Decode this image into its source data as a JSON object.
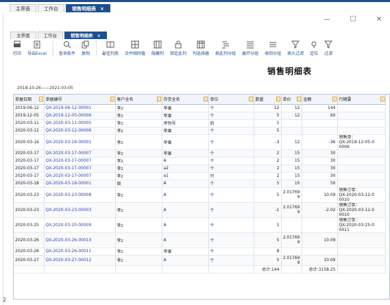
{
  "outer_tabs": [
    {
      "label": "主界面",
      "active": false
    },
    {
      "label": "工作台",
      "active": false
    },
    {
      "label": "销售明细表",
      "active": true,
      "closable": "×"
    }
  ],
  "window_controls": {
    "minimize": "—",
    "maximize": "☐",
    "close": "✕"
  },
  "inner_tabs": [
    {
      "label": "主界面",
      "active": false
    },
    {
      "label": "工作台",
      "active": false
    },
    {
      "label": "销售明细表",
      "active": true,
      "closable": "×"
    }
  ],
  "toolbar": [
    {
      "label": "打印",
      "icon": "printer-icon"
    },
    {
      "label": "导出Excel",
      "icon": "export-icon"
    },
    {
      "label": "查询条件",
      "icon": "search-icon"
    },
    {
      "label": "复制",
      "icon": "copy-icon"
    },
    {
      "label": "最佳列宽",
      "icon": "column-width-icon"
    },
    {
      "label": "合并相同值",
      "icon": "merge-icon"
    },
    {
      "label": "隐藏列",
      "icon": "hide-column-icon"
    },
    {
      "label": "锁定此列",
      "icon": "lock-icon"
    },
    {
      "label": "列选择器",
      "icon": "column-chooser-icon"
    },
    {
      "label": "按此列分组",
      "icon": "group-icon"
    },
    {
      "label": "展开分组",
      "icon": "expand-group-icon"
    },
    {
      "label": "收回分组",
      "icon": "collapse-group-icon"
    },
    {
      "label": "表头过滤",
      "icon": "filter-icon"
    },
    {
      "label": "定位",
      "icon": "locate-icon"
    },
    {
      "label": "过滤",
      "icon": "funnel-icon"
    }
  ],
  "report": {
    "title": "销售明细表",
    "date_range": "2018-10-26——2021-03-05"
  },
  "table": {
    "columns": [
      "单据日期",
      "单据编号",
      "客户全名",
      "存货全名",
      "单位",
      "数量",
      "单价",
      "金额",
      "行摘要"
    ],
    "rows": [
      {
        "date": "2019-06-12",
        "no": "QX-2019-06-12-00001",
        "customer": "李z",
        "item": "苹果",
        "unit": "个",
        "qty": "12",
        "price": "12",
        "amount": "144",
        "memo": "",
        "tall": false
      },
      {
        "date": "2019-12-05",
        "no": "QX-2019-12-05-00006",
        "customer": "李z",
        "item": "苹果",
        "unit": "个",
        "qty": "5",
        "price": "12",
        "amount": "60",
        "memo": "",
        "tall": false
      },
      {
        "date": "2020-03-11",
        "no": "QX-2020-03-11-00005",
        "customer": "李z",
        "item": "序列号",
        "unit": "的",
        "qty": "1",
        "price": "",
        "amount": "",
        "memo": "",
        "tall": false
      },
      {
        "date": "2020-03-12",
        "no": "QX-2020-03-12-00006",
        "customer": "李z",
        "item": "苹果",
        "unit": "个",
        "qty": "5",
        "price": "",
        "amount": "",
        "memo": "",
        "tall": false
      },
      {
        "date": "2020-03-16",
        "no": "QX-2020-03-16-00001",
        "customer": "李z",
        "item": "苹果",
        "unit": "个",
        "qty": "-3",
        "price": "12",
        "amount": "-36",
        "memo": "销售单：\nQX-2019-12-05-0\n0006",
        "tall": true
      },
      {
        "date": "2020-03-17",
        "no": "QX-2020-03-17-00007",
        "customer": "李z",
        "item": "苹果",
        "unit": "个",
        "qty": "2",
        "price": "15",
        "amount": "30",
        "memo": "",
        "tall": false
      },
      {
        "date": "2020-03-17",
        "no": "QX-2020-03-17-00007",
        "customer": "李z",
        "item": "A",
        "unit": "个",
        "qty": "2",
        "price": "15",
        "amount": "30",
        "memo": "",
        "tall": false
      },
      {
        "date": "2020-03-17",
        "no": "QX-2020-03-17-00007",
        "customer": "李z",
        "item": "a2",
        "unit": "个",
        "qty": "2",
        "price": "15",
        "amount": "30",
        "memo": "",
        "tall": false
      },
      {
        "date": "2020-03-17",
        "no": "QX-2020-03-17-00007",
        "customer": "李z",
        "item": "a1",
        "unit": "只",
        "qty": "2",
        "price": "15",
        "amount": "30",
        "memo": "",
        "tall": false
      },
      {
        "date": "2020-03-18",
        "no": "QX-2020-03-18-00001",
        "customer": "周",
        "item": "A",
        "unit": "个",
        "qty": "5",
        "price": "10",
        "amount": "50",
        "memo": "",
        "tall": false
      },
      {
        "date": "2020-03-23",
        "no": "QX-2020-03-23-00008",
        "customer": "李z",
        "item": "A",
        "unit": "个",
        "qty": "5",
        "price": "2.01769\n9",
        "amount": "10.09",
        "memo": "销售订单：\nQX-2020-03-12-0\n0010",
        "tall": true
      },
      {
        "date": "2020-03-23",
        "no": "QX-2020-03-23-00003",
        "customer": "李z",
        "item": "A",
        "unit": "个",
        "qty": "-1",
        "price": "2.01769\n9",
        "amount": "-2.02",
        "memo": "销售订单：\nQX-2020-03-12-0\n0010",
        "tall": true
      },
      {
        "date": "2020-03-25",
        "no": "QX-2020-03-25-00009",
        "customer": "李z",
        "item": "A",
        "unit": "个",
        "qty": "1",
        "price": "",
        "amount": "",
        "memo": "销售订单：\nQX-2020-03-25-0\n0011",
        "tall": true
      },
      {
        "date": "2020-03-26",
        "no": "QX-2020-03-26-00010",
        "customer": "李z",
        "item": "A",
        "unit": "个",
        "qty": "5",
        "price": "2.01769\n9",
        "amount": "10.09",
        "memo": "",
        "tall": true
      },
      {
        "date": "2020-03-26",
        "no": "QX-2020-03-26-00011",
        "customer": "李z",
        "item": "苹果",
        "unit": "个",
        "qty": "8",
        "price": "",
        "amount": "",
        "memo": "",
        "tall": false
      },
      {
        "date": "2020-03-27",
        "no": "QX-2020-03-27-00012",
        "customer": "李z",
        "item": "A",
        "unit": "个",
        "qty": "5",
        "price": "2.01769\n9",
        "amount": "10.09",
        "memo": "",
        "tall": false
      }
    ],
    "totals": {
      "qty": "总计:144",
      "amount": "总计:3158.25"
    }
  },
  "footnote": "2"
}
